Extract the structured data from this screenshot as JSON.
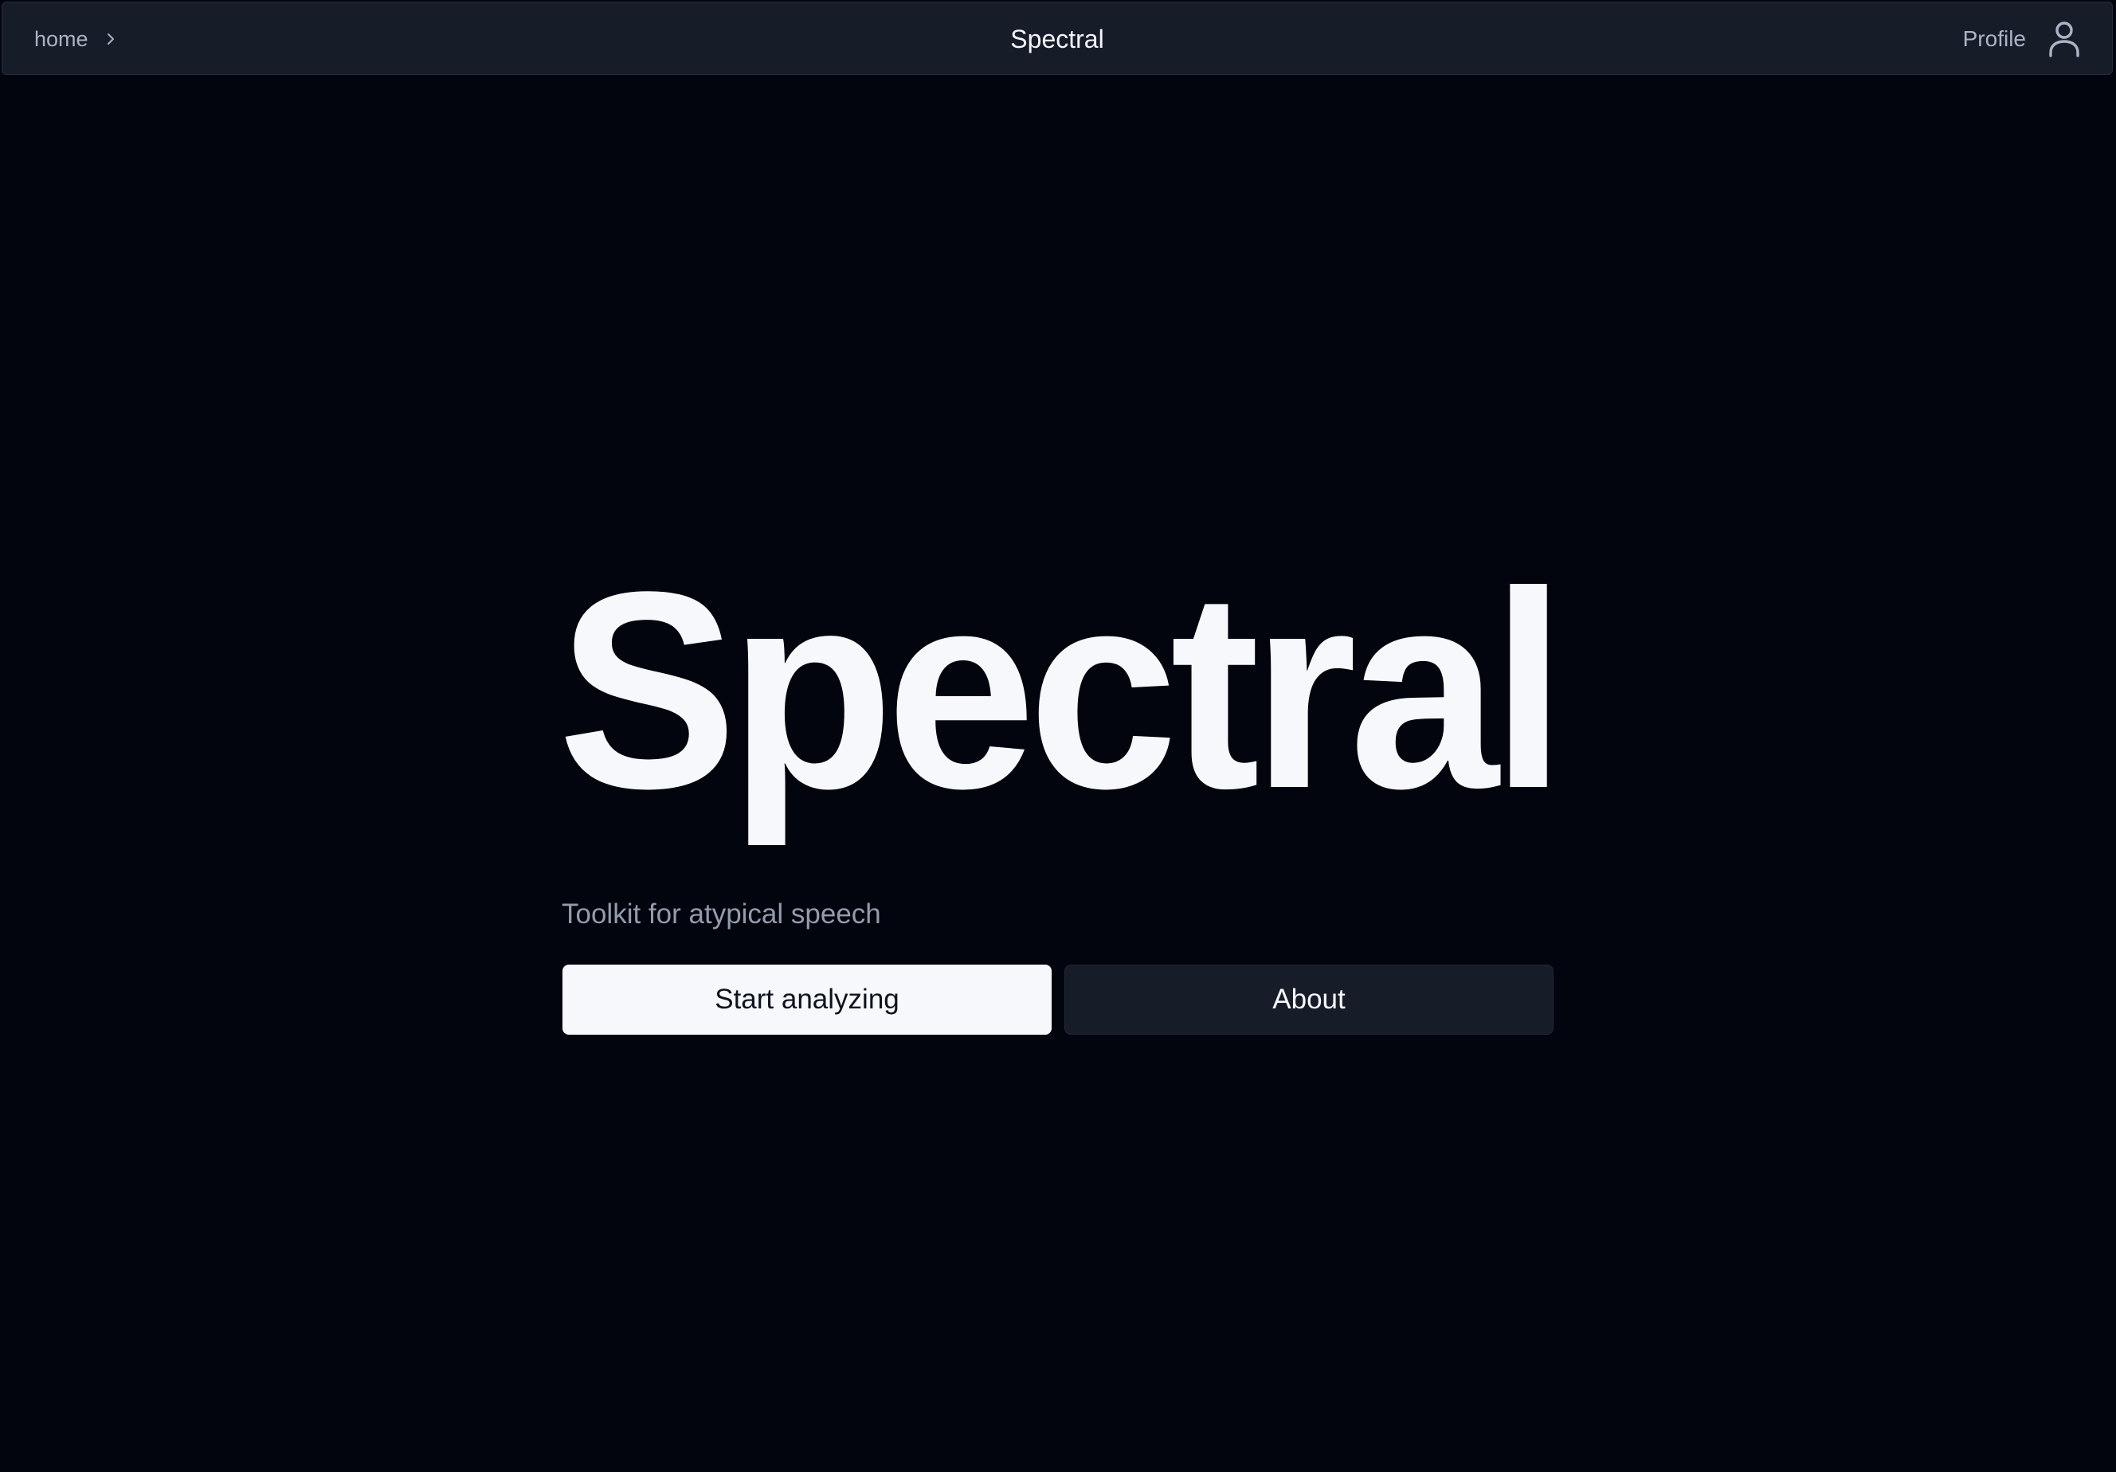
{
  "breadcrumb": {
    "items": [
      {
        "label": "home"
      }
    ],
    "separator_icon": "chevron-right-icon"
  },
  "header": {
    "title": "Spectral"
  },
  "profile": {
    "label": "Profile",
    "icon": "user-icon"
  },
  "hero": {
    "title": "Spectral",
    "tagline": "Toolkit for atypical speech",
    "primary_button": "Start analyzing",
    "secondary_button": "About"
  },
  "colors": {
    "background": "#03050e",
    "header_background": "#171c29",
    "primary_button_background": "#f7f8fb",
    "secondary_button_background": "#171c29",
    "muted_text": "#939cad"
  }
}
